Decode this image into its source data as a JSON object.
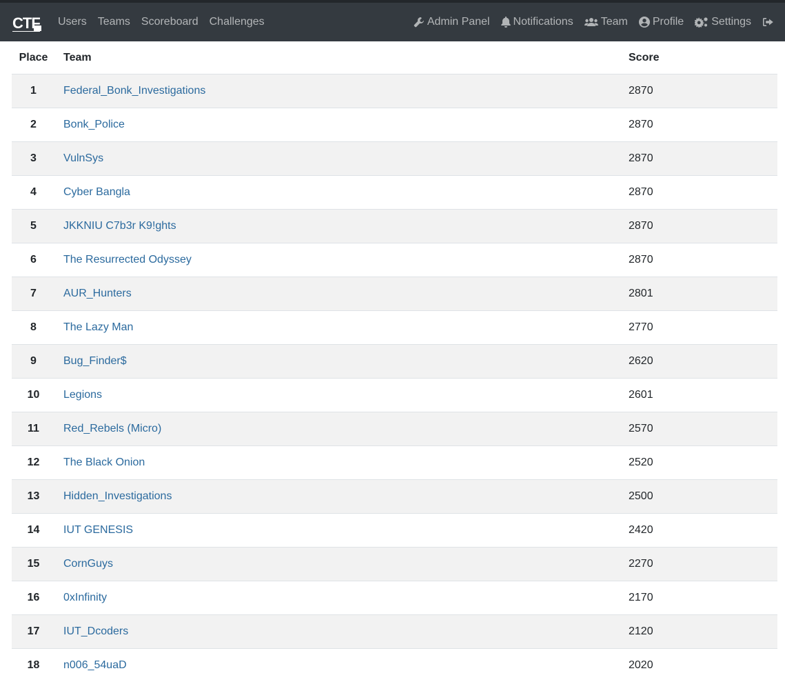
{
  "nav": {
    "left": [
      "Users",
      "Teams",
      "Scoreboard",
      "Challenges"
    ],
    "admin_panel": "Admin Panel",
    "notifications": "Notifications",
    "team": "Team",
    "profile": "Profile",
    "settings": "Settings",
    "icons": [
      "wrench-icon",
      "bell-icon",
      "users-icon",
      "user-circle-icon",
      "cogs-icon",
      "sign-out-icon"
    ]
  },
  "colors": {
    "navbar": "#343a40",
    "link": "#2b6a9e",
    "row_stripe": "#f2f2f2"
  },
  "table": {
    "headers": {
      "place": "Place",
      "team": "Team",
      "score": "Score"
    },
    "rows": [
      {
        "place": "1",
        "team": "Federal_Bonk_Investigations",
        "score": "2870"
      },
      {
        "place": "2",
        "team": "Bonk_Police",
        "score": "2870"
      },
      {
        "place": "3",
        "team": "VulnSys",
        "score": "2870"
      },
      {
        "place": "4",
        "team": "Cyber Bangla",
        "score": "2870"
      },
      {
        "place": "5",
        "team": "JKKNIU C7b3r K9!ghts",
        "score": "2870"
      },
      {
        "place": "6",
        "team": "The Resurrected Odyssey",
        "score": "2870"
      },
      {
        "place": "7",
        "team": "AUR_Hunters",
        "score": "2801"
      },
      {
        "place": "8",
        "team": "The Lazy Man",
        "score": "2770"
      },
      {
        "place": "9",
        "team": "Bug_Finder$",
        "score": "2620"
      },
      {
        "place": "10",
        "team": "Legions",
        "score": "2601"
      },
      {
        "place": "11",
        "team": "Red_Rebels (Micro)",
        "score": "2570"
      },
      {
        "place": "12",
        "team": "The Black Onion",
        "score": "2520"
      },
      {
        "place": "13",
        "team": "Hidden_Investigations",
        "score": "2500"
      },
      {
        "place": "14",
        "team": "IUT GENESIS",
        "score": "2420"
      },
      {
        "place": "15",
        "team": "CornGuys",
        "score": "2270"
      },
      {
        "place": "16",
        "team": "0xInfinity",
        "score": "2170"
      },
      {
        "place": "17",
        "team": "IUT_Dcoders",
        "score": "2120"
      },
      {
        "place": "18",
        "team": "n006_54uaD",
        "score": "2020"
      }
    ]
  }
}
